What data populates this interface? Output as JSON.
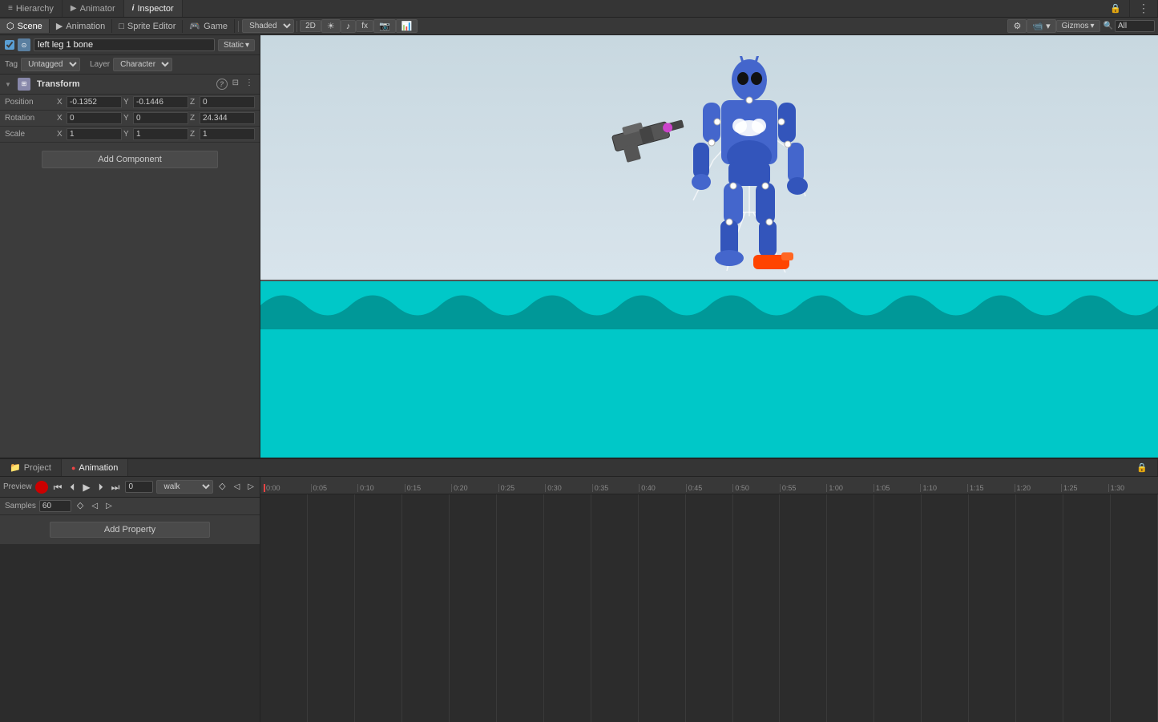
{
  "topBar": {
    "tabs": [
      {
        "id": "hierarchy",
        "label": "Hierarchy",
        "active": false,
        "icon": "≡"
      },
      {
        "id": "animator",
        "label": "Animator",
        "active": false,
        "icon": "▶"
      },
      {
        "id": "inspector",
        "label": "Inspector",
        "active": true,
        "icon": "ℹ"
      },
      {
        "id": "lock",
        "label": "",
        "active": false,
        "icon": "🔒"
      },
      {
        "id": "dots",
        "label": "",
        "active": false,
        "icon": "⋮"
      }
    ]
  },
  "sceneBar": {
    "tabs": [
      {
        "id": "scene",
        "label": "Scene",
        "active": true,
        "icon": "⬡"
      },
      {
        "id": "animation2",
        "label": "Animation",
        "active": false,
        "icon": "▶"
      },
      {
        "id": "sprite-editor",
        "label": "Sprite Editor",
        "active": false,
        "icon": "□"
      },
      {
        "id": "game",
        "label": "Game",
        "active": false,
        "icon": "🎮"
      }
    ],
    "shaded": "Shaded",
    "twoDMode": "2D",
    "gizmos": "Gizmos",
    "layers": "All"
  },
  "inspector": {
    "objectName": "left leg 1 bone",
    "staticLabel": "Static",
    "tagLabel": "Tag",
    "tagValue": "Untagged",
    "layerLabel": "Layer",
    "layerValue": "Character",
    "transform": {
      "title": "Transform",
      "position": {
        "x": "-0.1352",
        "y": "-0.1446",
        "z": "0"
      },
      "rotation": {
        "x": "0",
        "y": "0",
        "z": "24.344"
      },
      "scale": {
        "x": "1",
        "y": "1",
        "z": "1"
      }
    },
    "addComponentLabel": "Add Component"
  },
  "bottomPanel": {
    "tabs": [
      {
        "id": "project",
        "label": "Project",
        "active": false,
        "icon": "📁"
      },
      {
        "id": "animation",
        "label": "Animation",
        "active": true,
        "icon": "●"
      }
    ],
    "animation": {
      "previewLabel": "Preview",
      "recordLabel": "",
      "timeValue": "0",
      "clipName": "walk",
      "samplesLabel": "Samples",
      "samplesValue": "60",
      "addPropertyLabel": "Add Property",
      "timeline": {
        "markers": [
          "0:00",
          "0:05",
          "0:10",
          "0:15",
          "0:20",
          "0:25",
          "0:30",
          "0:35",
          "0:40",
          "0:45",
          "0:50",
          "0:55",
          "1:00",
          "1:05",
          "1:10",
          "1:15",
          "1:20",
          "1:25",
          "1:30"
        ]
      }
    }
  }
}
